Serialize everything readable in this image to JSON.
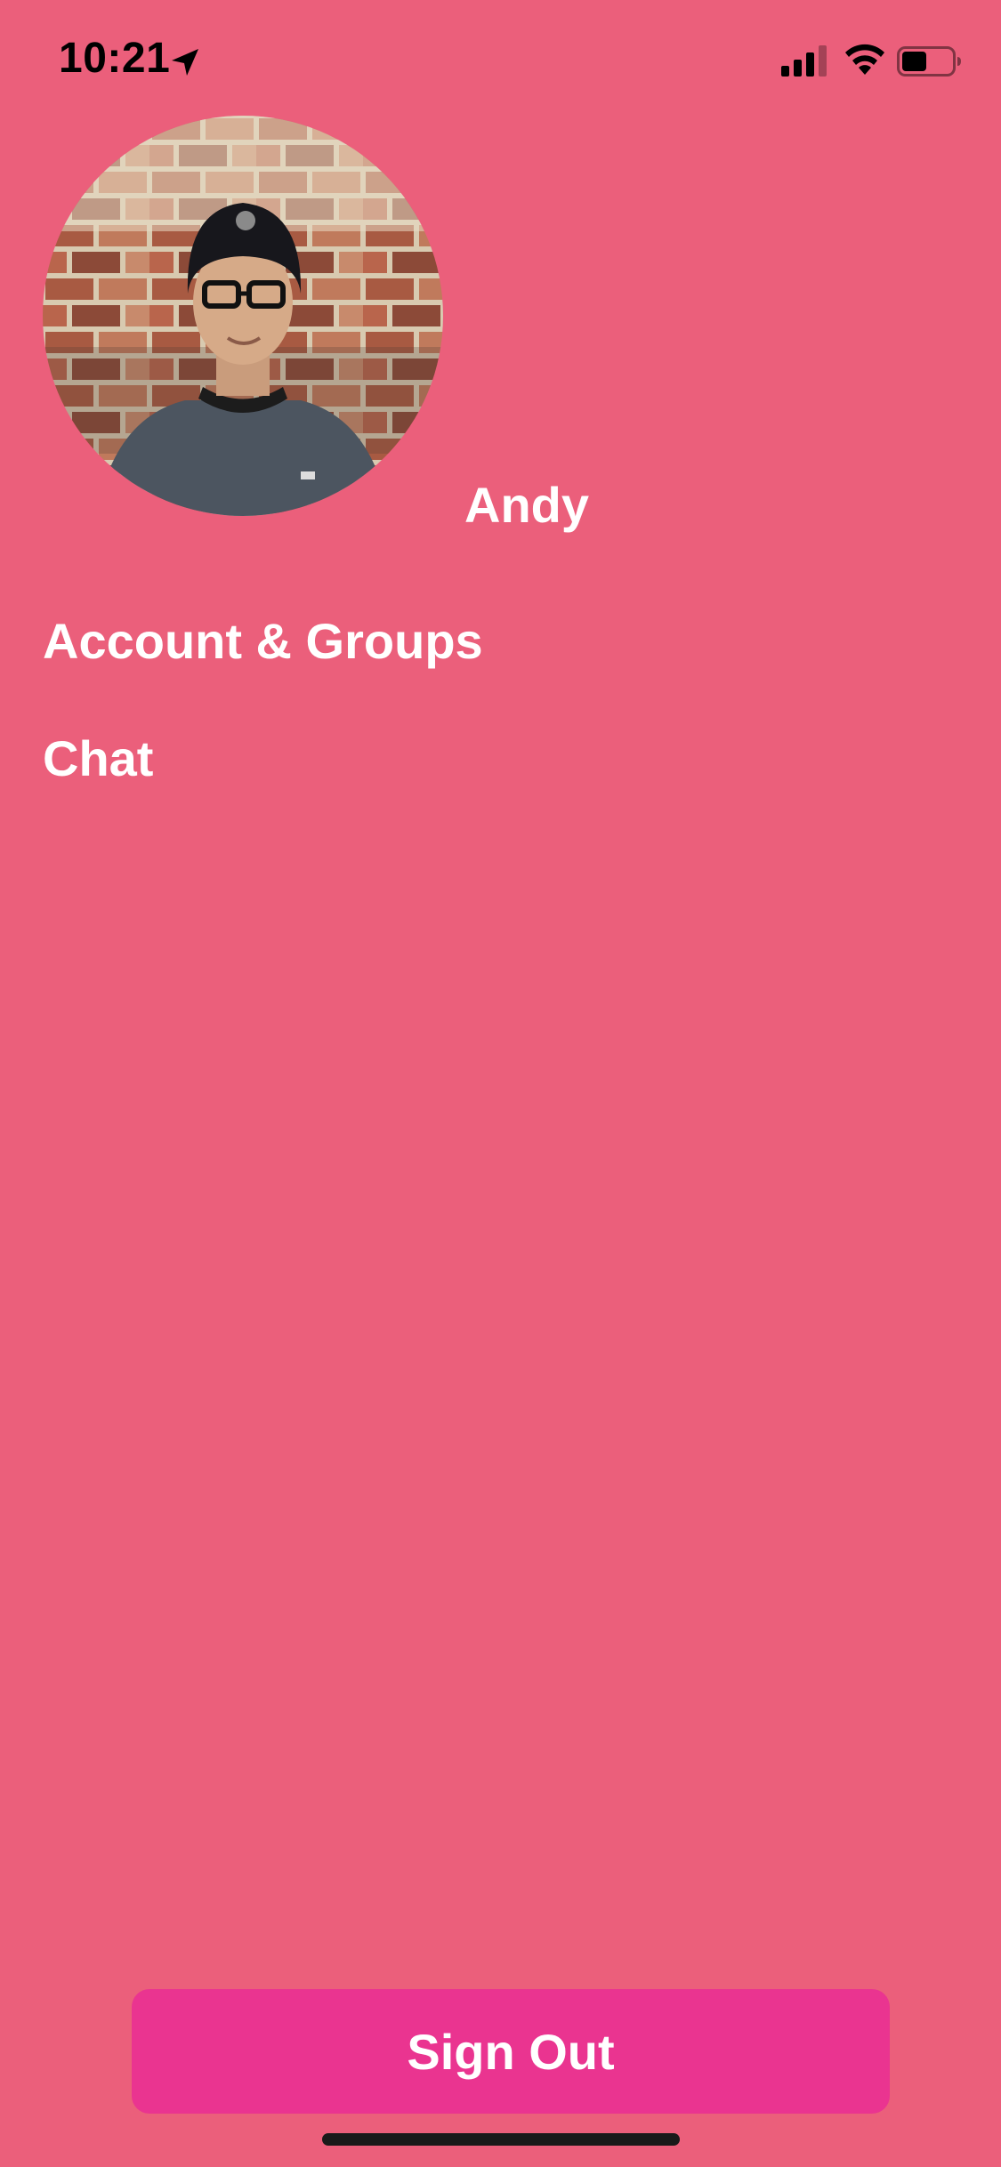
{
  "status_bar": {
    "time": "10:21",
    "icons": [
      "location-arrow-icon",
      "cellular-signal-icon",
      "wifi-icon",
      "battery-icon"
    ]
  },
  "profile": {
    "name": "Andy",
    "avatar": "profile-photo"
  },
  "menu": {
    "items": [
      {
        "label": "Account & Groups"
      },
      {
        "label": "Chat"
      }
    ]
  },
  "actions": {
    "sign_out_label": "Sign Out"
  },
  "colors": {
    "background": "#EB5F7B",
    "button": "#EA3490",
    "text": "#FFFFFF"
  }
}
